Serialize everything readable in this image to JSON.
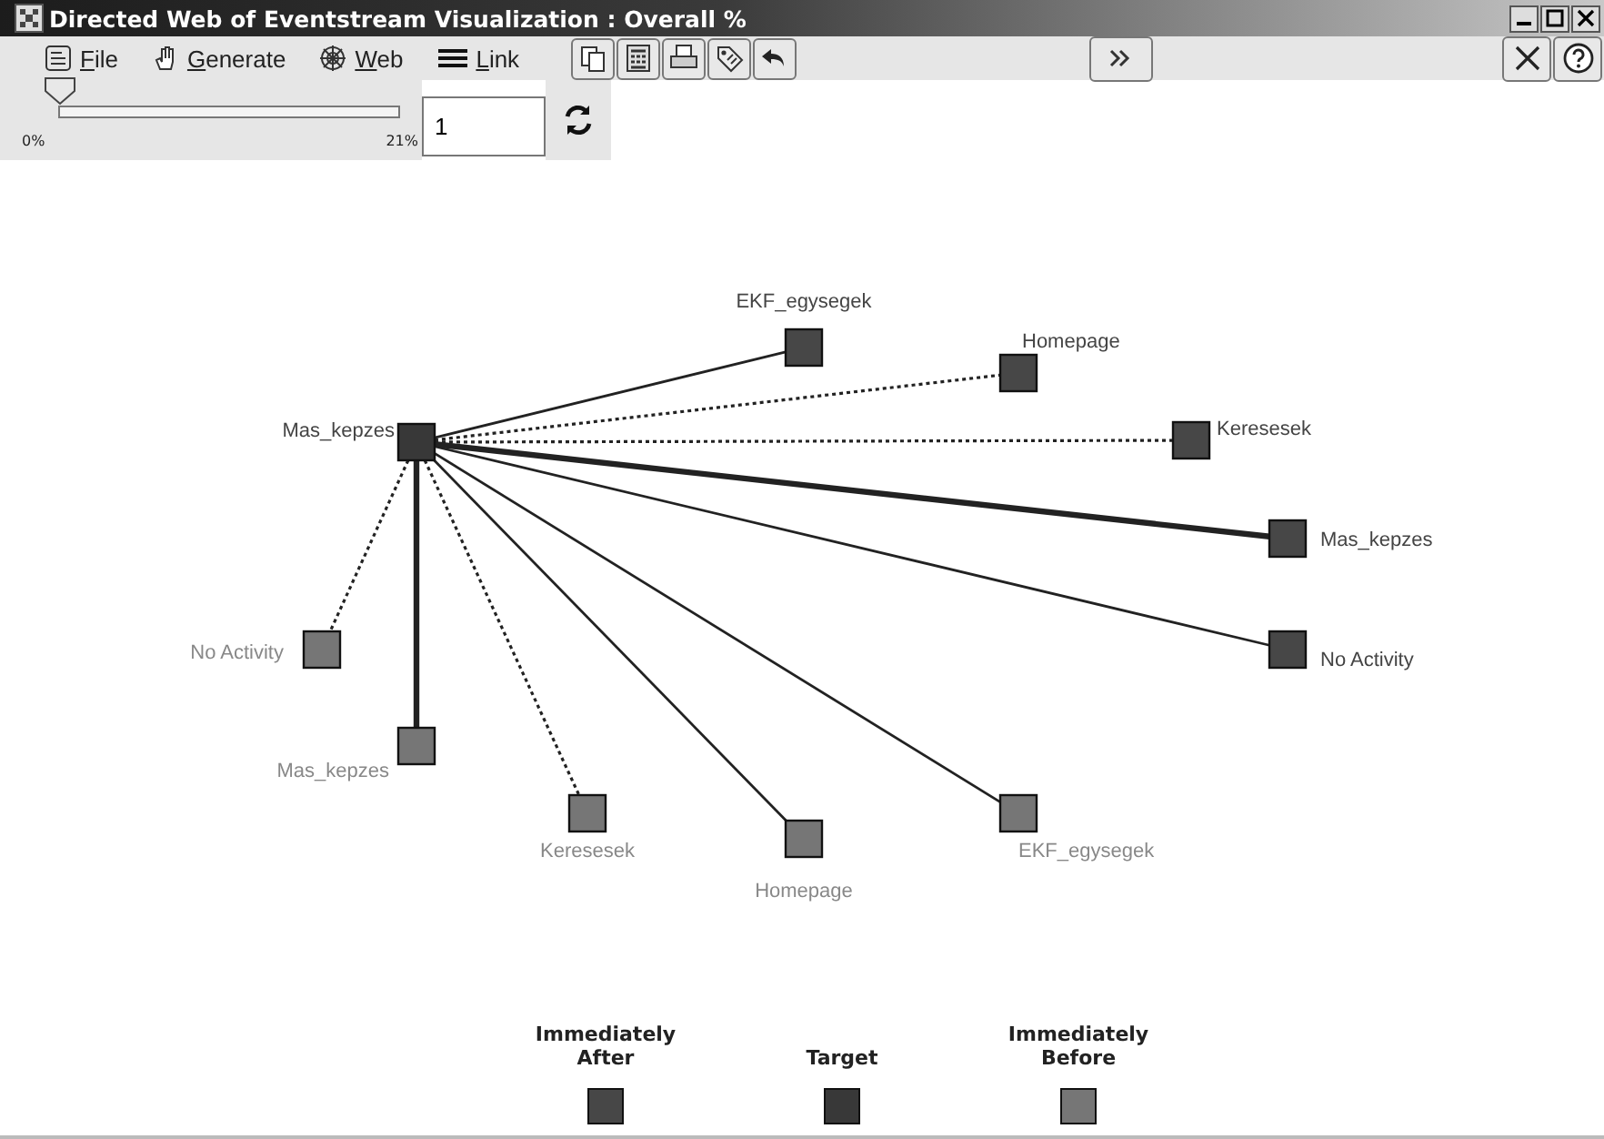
{
  "window": {
    "title": "Directed Web of Eventstream Visualization : Overall %"
  },
  "menu": [
    {
      "label": "File"
    },
    {
      "label": "Generate"
    },
    {
      "label": "Web"
    },
    {
      "label": "Link"
    }
  ],
  "slider": {
    "level": 0,
    "min_label": "0%",
    "max_label": "21%"
  },
  "field": {
    "value": "1"
  },
  "nodes": [
    {
      "label": "Mas_kepzes",
      "kind": "target"
    },
    {
      "label": "EKF_egysegek",
      "kind": "after"
    },
    {
      "label": "Homepage",
      "kind": "after"
    },
    {
      "label": "Keresesek",
      "kind": "after"
    },
    {
      "label": "Mas_kepzes",
      "kind": "after"
    },
    {
      "label": "No Activity",
      "kind": "after"
    },
    {
      "label": "No Activity",
      "kind": "before"
    },
    {
      "label": "Mas_kepzes",
      "kind": "before"
    },
    {
      "label": "Keresesek",
      "kind": "before"
    },
    {
      "label": "Homepage",
      "kind": "before"
    },
    {
      "label": "EKF_egysegek",
      "kind": "before"
    }
  ],
  "links": [
    {
      "kind": "solid"
    },
    {
      "kind": "dotted"
    },
    {
      "kind": "dotted"
    },
    {
      "kind": "thick"
    },
    {
      "kind": "solid"
    },
    {
      "kind": "dotted"
    },
    {
      "kind": "thick"
    },
    {
      "kind": "dotted"
    },
    {
      "kind": "solid"
    },
    {
      "kind": "solid"
    }
  ],
  "legend": [
    {
      "label": "Immediately After",
      "kind": "after"
    },
    {
      "label": "Target",
      "kind": "target"
    },
    {
      "label": "Immediately Before",
      "kind": "before"
    }
  ]
}
